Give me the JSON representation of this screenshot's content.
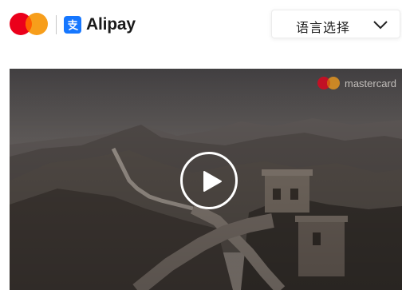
{
  "header": {
    "partner_logo": "mastercard-logo",
    "brand_name": "Alipay",
    "brand_icon": "alipay-icon",
    "language_select": {
      "label": "语言选择",
      "icon": "chevron-down-icon"
    }
  },
  "video": {
    "watermark_text": "mastercard",
    "watermark_icon": "mastercard-logo",
    "play_icon": "play-icon"
  },
  "colors": {
    "mastercard_red": "#eb001b",
    "mastercard_yellow": "#f79e1b",
    "mastercard_overlap": "#ff5f00",
    "alipay_blue": "#1677ff"
  }
}
